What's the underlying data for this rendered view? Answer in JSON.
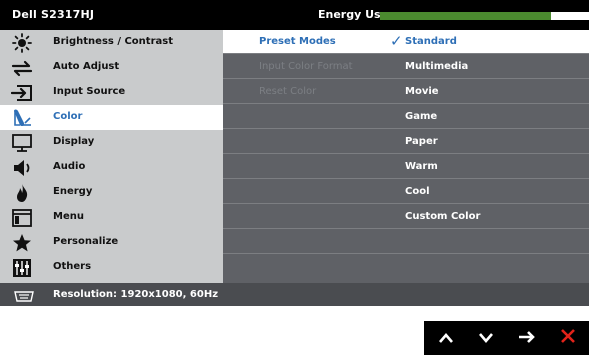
{
  "title_bar": {
    "model": "Dell S2317HJ",
    "energy_label": "Energy Use",
    "energy_level_percent": 82,
    "energy_color": "#4b8a2f"
  },
  "menu": {
    "items": [
      {
        "label": "Brightness / Contrast",
        "icon": "sun-icon"
      },
      {
        "label": "Auto Adjust",
        "icon": "swap-arrows-icon"
      },
      {
        "label": "Input Source",
        "icon": "input-arrow-icon"
      },
      {
        "label": "Color",
        "icon": "color-palette-icon",
        "selected": true
      },
      {
        "label": "Display",
        "icon": "monitor-icon"
      },
      {
        "label": "Audio",
        "icon": "speaker-icon"
      },
      {
        "label": "Energy",
        "icon": "flame-icon"
      },
      {
        "label": "Menu",
        "icon": "menu-window-icon"
      },
      {
        "label": "Personalize",
        "icon": "star-icon"
      },
      {
        "label": "Others",
        "icon": "sliders-icon"
      }
    ]
  },
  "submenu": {
    "labels": [
      "Preset Modes",
      "Input Color Format",
      "Reset Color"
    ],
    "options": [
      "Standard",
      "Multimedia",
      "Movie",
      "Game",
      "Paper",
      "Warm",
      "Cool",
      "Custom Color"
    ],
    "selected_option": "Standard"
  },
  "status_bar": {
    "resolution": "Resolution: 1920x1080, 60Hz"
  },
  "nav_buttons": [
    "up-arrow",
    "down-arrow",
    "right-arrow",
    "close"
  ],
  "colors": {
    "accent": "#2e6fb6",
    "close": "#e2231a"
  }
}
